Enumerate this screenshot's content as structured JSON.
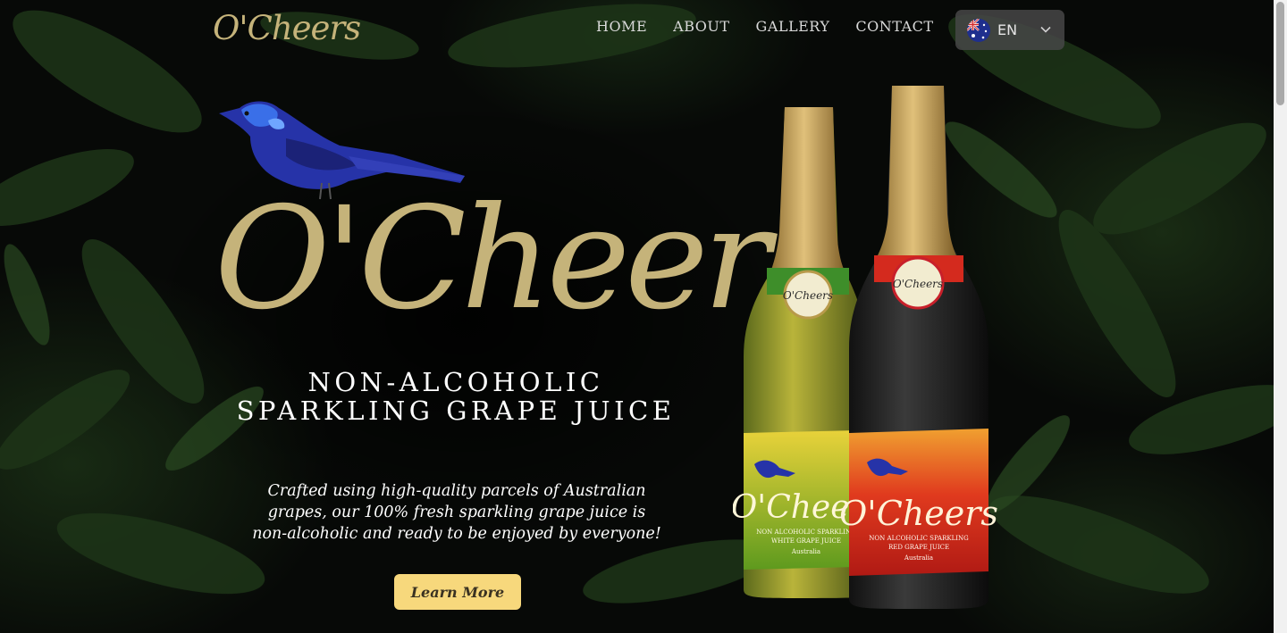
{
  "brand": {
    "name": "O'Cheers"
  },
  "nav": {
    "items": [
      {
        "label": "HOME"
      },
      {
        "label": "ABOUT"
      },
      {
        "label": "GALLERY"
      },
      {
        "label": "CONTACT"
      }
    ]
  },
  "language": {
    "code": "EN",
    "flag_icon": "australia-flag-icon",
    "chevron_icon": "chevron-down-icon"
  },
  "hero": {
    "logo": "O'Cheers",
    "tagline_line1": "NON-ALCOHOLIC",
    "tagline_line2": "SPARKLING GRAPE JUICE",
    "description": "Crafted using high-quality parcels of Australian grapes, our 100% fresh sparkling grape juice is non-alcoholic and ready to be enjoyed by everyone!",
    "cta_label": "Learn More"
  },
  "products": [
    {
      "seal": "O'Cheers",
      "brand": "O'Cheers",
      "line1": "NON ALCOHOLIC SPARKLING",
      "line2": "WHITE GRAPE JUICE",
      "origin": "Australia"
    },
    {
      "seal": "O'Cheers",
      "brand": "O'Cheers",
      "line1": "NON ALCOHOLIC SPARKLING",
      "line2": "RED GRAPE JUICE",
      "origin": "Australia"
    }
  ],
  "colors": {
    "gold": "#c5b37a",
    "cta_background": "#f7d87c",
    "background": "#070907",
    "white_label": "#9fbf2a",
    "red_label": "#d42a1e"
  }
}
